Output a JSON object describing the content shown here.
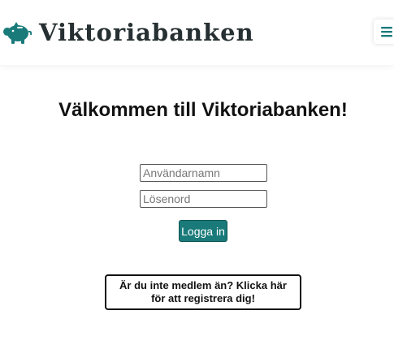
{
  "header": {
    "brand_name": "Viktoriabanken",
    "logo_icon": "piggy-bank-icon",
    "menu_icon": "hamburger-menu-icon"
  },
  "main": {
    "title": "Välkommen till Viktoriabanken!",
    "username": {
      "value": "",
      "placeholder": "Användarnamn"
    },
    "password": {
      "value": "",
      "placeholder": "Lösenord"
    },
    "login_button": "Logga in",
    "register_link": "Är du inte medlem än? Klicka här för att registrera dig!"
  },
  "colors": {
    "brand": "#1a7a7a",
    "text_dark": "#263033"
  }
}
